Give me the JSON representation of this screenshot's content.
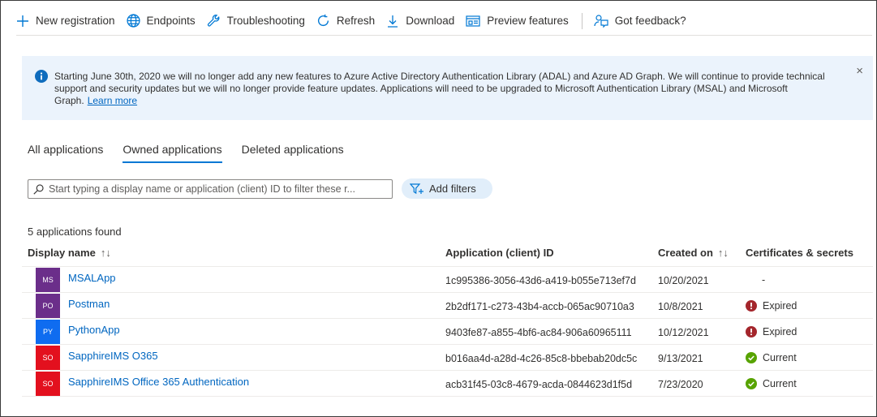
{
  "toolbar": {
    "new_registration": "New registration",
    "endpoints": "Endpoints",
    "troubleshooting": "Troubleshooting",
    "refresh": "Refresh",
    "download": "Download",
    "preview_features": "Preview features",
    "feedback": "Got feedback?"
  },
  "banner": {
    "text": "Starting June 30th, 2020 we will no longer add any new features to Azure Active Directory Authentication Library (ADAL) and Azure AD Graph. We will continue to provide technical support and security updates but we will no longer provide feature updates. Applications will need to be upgraded to Microsoft Authentication Library (MSAL) and Microsoft Graph.",
    "link": "Learn more",
    "close": "×"
  },
  "tabs": {
    "all": "All applications",
    "owned": "Owned applications",
    "deleted": "Deleted applications"
  },
  "search": {
    "placeholder": "Start typing a display name or application (client) ID to filter these r..."
  },
  "filters": {
    "label": "Add filters"
  },
  "results": {
    "count": "5 applications found"
  },
  "table": {
    "headers": {
      "name": "Display name",
      "app_id": "Application (client) ID",
      "created": "Created on",
      "certs": "Certificates & secrets"
    },
    "rows": [
      {
        "initials": "MS",
        "color": "#6b2e8a",
        "name": "MSALApp",
        "app_id": "1c995386-3056-43d6-a419-b055e713ef7d",
        "created": "10/20/2021",
        "cert": "-",
        "cert_status": "none"
      },
      {
        "initials": "PO",
        "color": "#6b2e8a",
        "name": "Postman",
        "app_id": "2b2df171-c273-43b4-accb-065ac90710a3",
        "created": "10/8/2021",
        "cert": "Expired",
        "cert_status": "error"
      },
      {
        "initials": "PY",
        "color": "#0f6cf0",
        "name": "PythonApp",
        "app_id": "9403fe87-a855-4bf6-ac84-906a60965111",
        "created": "10/12/2021",
        "cert": "Expired",
        "cert_status": "error"
      },
      {
        "initials": "SO",
        "color": "#e3101e",
        "name": "SapphireIMS O365",
        "app_id": "b016aa4d-a28d-4c26-85c8-bbebab20dc5c",
        "created": "9/13/2021",
        "cert": "Current",
        "cert_status": "ok"
      },
      {
        "initials": "SO",
        "color": "#e3101e",
        "name": "SapphireIMS Office 365 Authentication",
        "app_id": "acb31f45-03c8-4679-acda-0844623d1f5d",
        "created": "7/23/2020",
        "cert": "Current",
        "cert_status": "ok"
      }
    ]
  },
  "colors": {
    "accent": "#0078d4",
    "link": "#0066c0",
    "error": "#a4262c",
    "success": "#57a300",
    "banner_bg": "#ebf3fc"
  }
}
